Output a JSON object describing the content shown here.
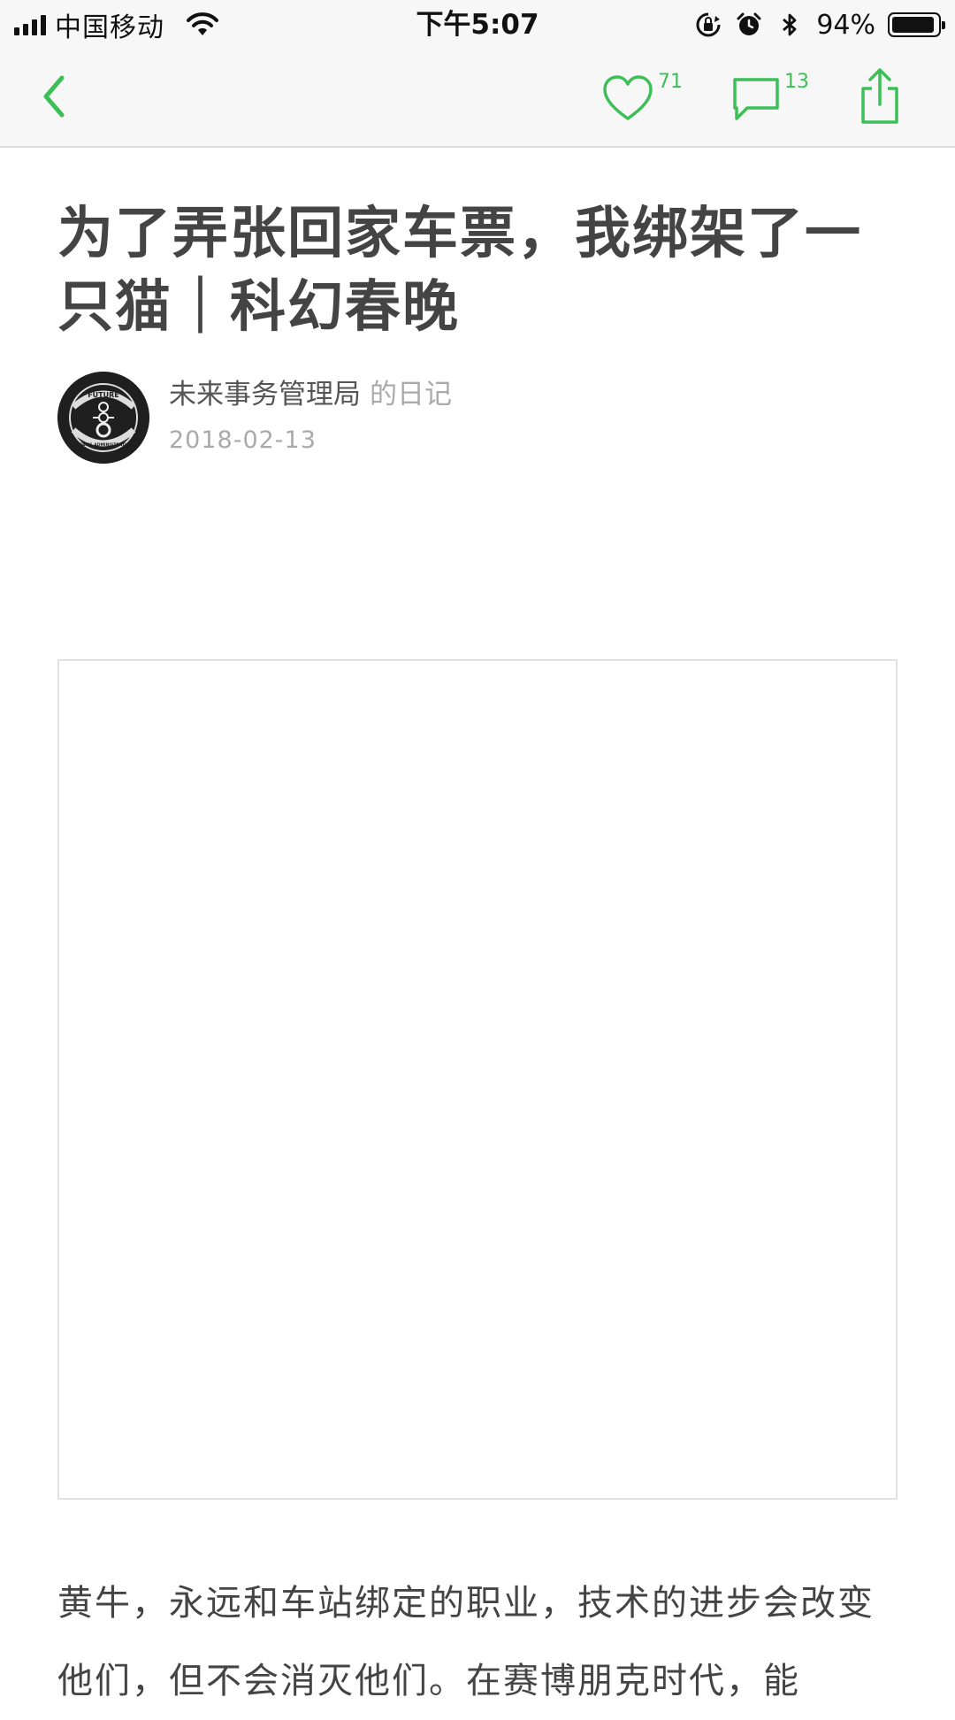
{
  "status_bar": {
    "carrier": "中国移动",
    "time": "下午5:07",
    "battery_percent": "94%",
    "battery_level": 0.94
  },
  "nav": {
    "like_count": "71",
    "comment_count": "13",
    "accent_color": "#3dbf58"
  },
  "article": {
    "title": "为了弄张回家车票，我绑架了一只猫｜科幻春晚",
    "author_name": "未来事务管理局",
    "diary_label": "的日记",
    "date": "2018-02-13",
    "avatar_text": {
      "top": "FUTURE",
      "bottom": "AFFAIRS ADMINISTRATION"
    },
    "body": "黄牛，永远和车站绑定的职业，技术的进步会改变他们，但不会消灭他们。在赛博朋克时代，能"
  }
}
